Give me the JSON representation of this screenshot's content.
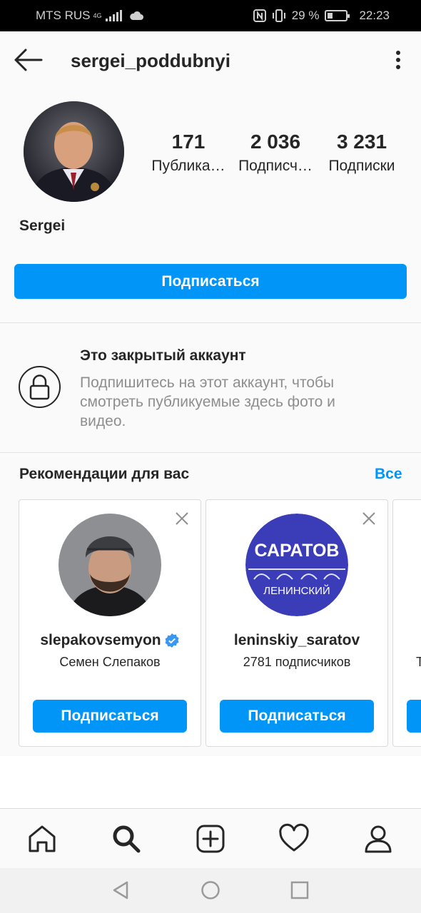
{
  "status_bar": {
    "carrier": "MTS RUS",
    "network": "4G",
    "battery_percent": "29 %",
    "battery_level": 0.29,
    "time": "22:23"
  },
  "header": {
    "username": "sergei_poddubnyi"
  },
  "profile": {
    "stats": [
      {
        "value": "171",
        "label": "Публика…"
      },
      {
        "value": "2 036",
        "label": "Подписч…"
      },
      {
        "value": "3 231",
        "label": "Подписки"
      }
    ],
    "name": "Sergei",
    "follow_label": "Подписаться"
  },
  "private": {
    "title": "Это закрытый аккаунт",
    "description": "Подпишитесь на этот аккаунт, чтобы смотреть публикуемые здесь фото и видео."
  },
  "recommendations": {
    "title": "Рекомендации для вас",
    "see_all": "Все",
    "cards": [
      {
        "username": "slepakovsemyon",
        "subtitle": "Семен Слепаков",
        "verified": true,
        "follow_label": "Подписаться"
      },
      {
        "username": "leninskiy_saratov",
        "subtitle": "2781 подписчиков",
        "verified": false,
        "follow_label": "Подписаться",
        "logo_top": "САРАТОВ",
        "logo_bottom": "ЛЕНИНСКИЙ"
      },
      {
        "partial_subtitle": "Т"
      }
    ]
  },
  "colors": {
    "accent": "#0095f6",
    "text": "#262626",
    "muted": "#8e8e8e"
  },
  "nav": {
    "items": [
      "home-icon",
      "search-icon",
      "new-post-icon",
      "activity-heart-icon",
      "profile-icon"
    ]
  }
}
